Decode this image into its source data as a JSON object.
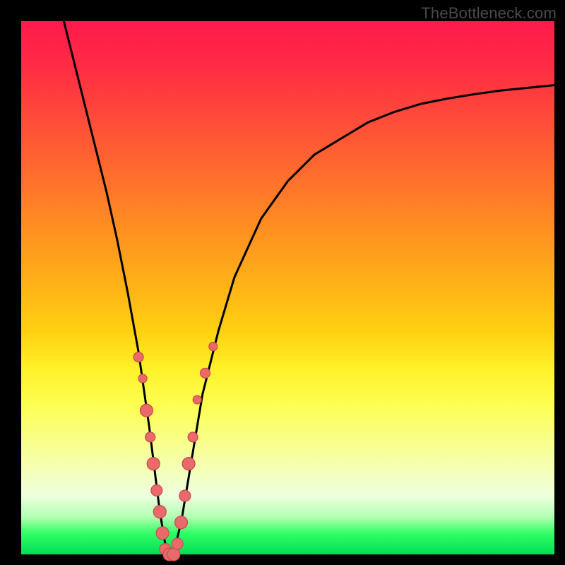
{
  "watermark": "TheBottleneck.com",
  "colors": {
    "frame": "#000000",
    "curve": "#000000",
    "dot_fill": "#e96a6a",
    "dot_stroke": "#c94a4a"
  },
  "chart_data": {
    "type": "line",
    "title": "",
    "xlabel": "",
    "ylabel": "",
    "xlim": [
      0,
      100
    ],
    "ylim": [
      0,
      100
    ],
    "series": [
      {
        "name": "bottleneck-curve",
        "x": [
          8,
          10,
          12,
          14,
          16,
          18,
          20,
          22,
          24,
          26,
          27,
          28,
          29,
          30,
          32,
          34,
          37,
          40,
          45,
          50,
          55,
          60,
          65,
          70,
          75,
          80,
          85,
          90,
          95,
          100
        ],
        "y": [
          100,
          92,
          84,
          76,
          68,
          59,
          49,
          38,
          24,
          8,
          2,
          0,
          2,
          6,
          18,
          30,
          42,
          52,
          63,
          70,
          75,
          78,
          81,
          83,
          84.5,
          85.5,
          86.3,
          87,
          87.5,
          88
        ]
      }
    ],
    "scatter": [
      {
        "name": "data-points",
        "points": [
          {
            "x": 22.0,
            "y": 37,
            "r": 7
          },
          {
            "x": 22.8,
            "y": 33,
            "r": 6
          },
          {
            "x": 23.5,
            "y": 27,
            "r": 9
          },
          {
            "x": 24.2,
            "y": 22,
            "r": 7
          },
          {
            "x": 24.8,
            "y": 17,
            "r": 9
          },
          {
            "x": 25.4,
            "y": 12,
            "r": 8
          },
          {
            "x": 26.0,
            "y": 8,
            "r": 9
          },
          {
            "x": 26.5,
            "y": 4,
            "r": 9
          },
          {
            "x": 27.0,
            "y": 1,
            "r": 8
          },
          {
            "x": 27.8,
            "y": 0,
            "r": 9
          },
          {
            "x": 28.6,
            "y": 0,
            "r": 9
          },
          {
            "x": 29.3,
            "y": 2,
            "r": 8
          },
          {
            "x": 30.0,
            "y": 6,
            "r": 9
          },
          {
            "x": 30.7,
            "y": 11,
            "r": 8
          },
          {
            "x": 31.4,
            "y": 17,
            "r": 9
          },
          {
            "x": 32.2,
            "y": 22,
            "r": 7
          },
          {
            "x": 33.0,
            "y": 29,
            "r": 6
          },
          {
            "x": 34.5,
            "y": 34,
            "r": 7
          },
          {
            "x": 36.0,
            "y": 39,
            "r": 6
          }
        ]
      }
    ],
    "background_gradient": {
      "top": "#ff1a4d",
      "upper_mid": "#ff8c22",
      "mid": "#fff028",
      "lower_mid": "#f6ffa4",
      "bottom": "#00dd55"
    }
  }
}
